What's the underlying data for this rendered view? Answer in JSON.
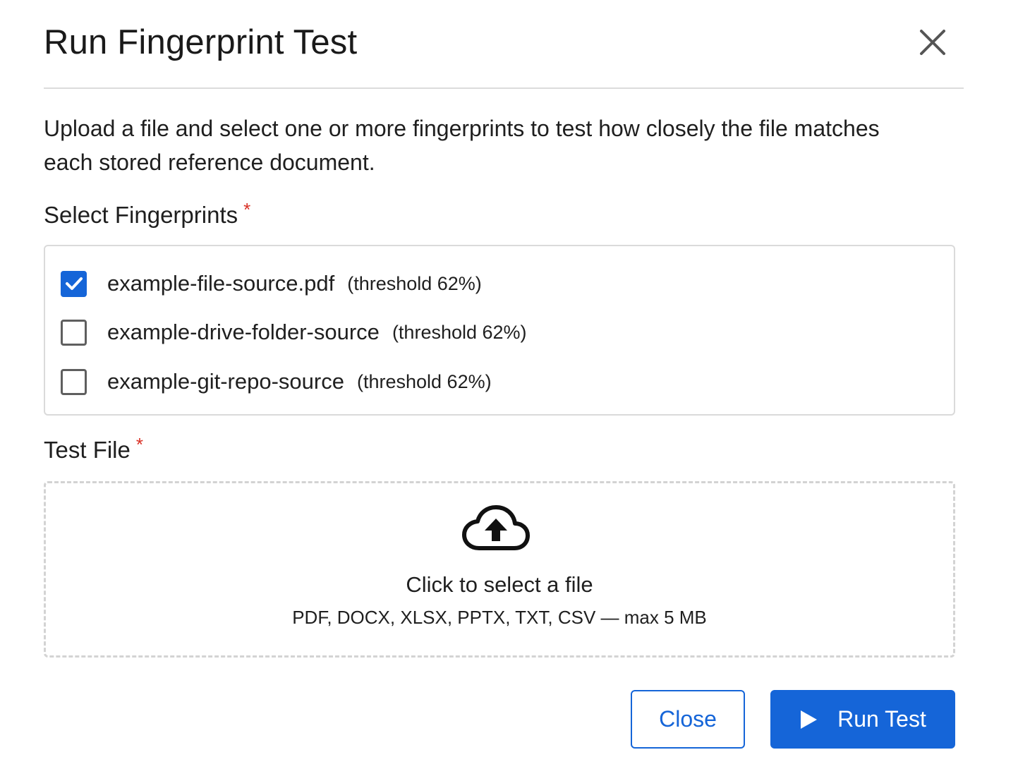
{
  "dialog": {
    "title": "Run Fingerprint Test",
    "description": "Upload a file and select one or more fingerprints to test how closely the file matches each stored reference document."
  },
  "fingerprints": {
    "label": "Select Fingerprints",
    "required_marker": "*",
    "items": [
      {
        "name": "example-file-source.pdf",
        "threshold": "(threshold 62%)",
        "checked": true
      },
      {
        "name": "example-drive-folder-source",
        "threshold": "(threshold 62%)",
        "checked": false
      },
      {
        "name": "example-git-repo-source",
        "threshold": "(threshold 62%)",
        "checked": false
      }
    ]
  },
  "test_file": {
    "label": "Test File",
    "required_marker": "*",
    "dropzone_title": "Click to select a file",
    "dropzone_hint": "PDF, DOCX, XLSX, PPTX, TXT, CSV — max 5 MB"
  },
  "actions": {
    "close_label": "Close",
    "run_label": "Run Test"
  },
  "icons": {
    "close": "close-icon",
    "check": "checkmark-icon",
    "upload": "cloud-upload-icon",
    "play": "play-icon"
  },
  "colors": {
    "primary": "#1565d8",
    "required": "#d93025",
    "border": "#dadada"
  }
}
